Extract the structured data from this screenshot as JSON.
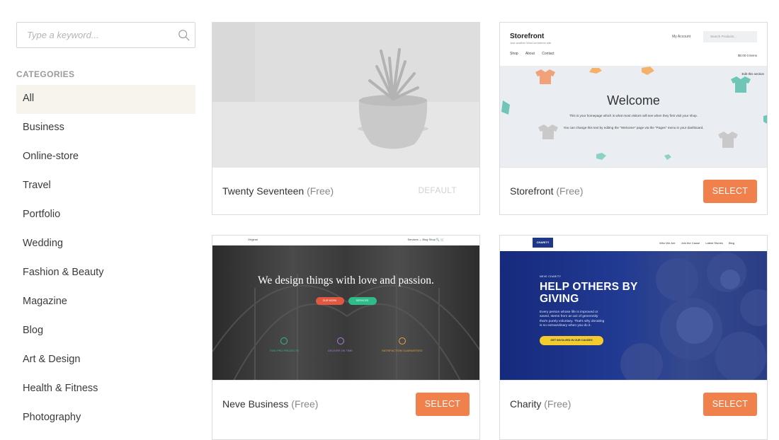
{
  "search": {
    "placeholder": "Type a keyword..."
  },
  "sidebar": {
    "title": "CATEGORIES",
    "items": [
      "All",
      "Business",
      "Online-store",
      "Travel",
      "Portfolio",
      "Wedding",
      "Fashion & Beauty",
      "Magazine",
      "Blog",
      "Art & Design",
      "Health & Fitness",
      "Photography"
    ],
    "active": "All"
  },
  "themes": [
    {
      "name": "Twenty Seventeen",
      "price": "(Free)",
      "action": "DEFAULT"
    },
    {
      "name": "Storefront",
      "price": "(Free)",
      "action": "SELECT",
      "preview": {
        "logo": "Storefront",
        "tagline": "Just another WooCommerce site",
        "nav": [
          "Shop",
          "About",
          "Contact"
        ],
        "account": "My Account",
        "search_placeholder": "Search Products…",
        "cart": "$0.00  0 items",
        "edit": "Edit this section",
        "heading": "Welcome",
        "line1": "This is your homepage which is what most visitors will see when they first visit your shop.",
        "line2": "You can change this text by editing the \"Welcome\" page via the \"Pages\" menu in your dashboard."
      }
    },
    {
      "name": "Neve Business",
      "price": "(Free)",
      "action": "SELECT",
      "preview": {
        "logo": "Original",
        "nav": "Services ⌄   Blog   Shop   🔍   🛒",
        "heading": "We design things with love and passion.",
        "btn1": "OUR WORK",
        "btn2": "SERVICES",
        "features": [
          "TWO PRO PROJECTS",
          "DELIVER ON TIME",
          "SATISFACTION GUARANTEED"
        ]
      }
    },
    {
      "name": "Charity",
      "price": "(Free)",
      "action": "SELECT",
      "preview": {
        "logo": "CHARITY",
        "nav": [
          "Who We Are",
          "Join the Cause",
          "Latest Stories",
          "Blog"
        ],
        "eyebrow": "NEVE CHARITY",
        "heading": "HELP OTHERS BY GIVING",
        "text": "Every person whose life is improved or saved, stems from an act of generosity that's purely voluntary. That's why donating is so extraordinary when you do it.",
        "btn": "GET INVOLVED IN OUR CAUSES"
      }
    }
  ],
  "colors": {
    "accent": "#f0804c",
    "active_bg": "#f7f4ee",
    "charity_blue": "#1f3787"
  }
}
